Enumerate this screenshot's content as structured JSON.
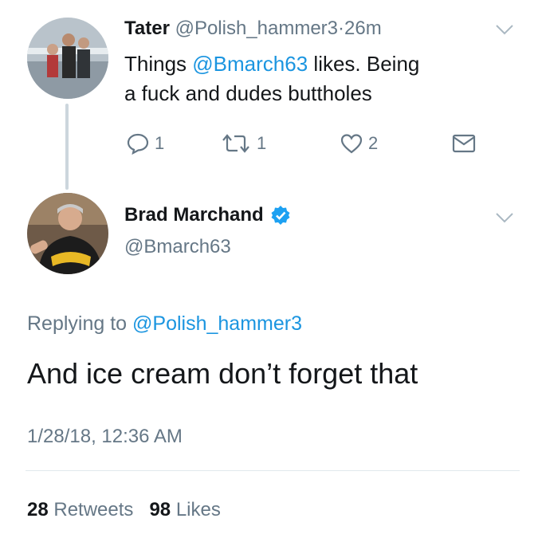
{
  "reply_tweet": {
    "display_name": "Tater",
    "handle": "@Polish_hammer3",
    "separator": "·",
    "time": "26m",
    "text_prefix": "Things",
    "text_mention": "@Bmarch63",
    "text_rest": "likes. Being",
    "text_line2": "a fuck and dudes buttholes",
    "actions": {
      "reply_count": "1",
      "retweet_count": "1",
      "like_count": "2"
    }
  },
  "main_tweet": {
    "display_name": "Brad Marchand",
    "verified": true,
    "handle": "@Bmarch63",
    "replying_label": "Replying to",
    "replying_handle": "@Polish_hammer3",
    "text": "And ice cream don’t forget that",
    "timestamp": "1/28/18, 12:36 AM",
    "retweet_count": "28",
    "retweet_label": "Retweets",
    "like_count": "98",
    "like_label": "Likes"
  },
  "colors": {
    "link": "#1b95e0",
    "muted": "#657786",
    "verified": "#1da1f2"
  }
}
